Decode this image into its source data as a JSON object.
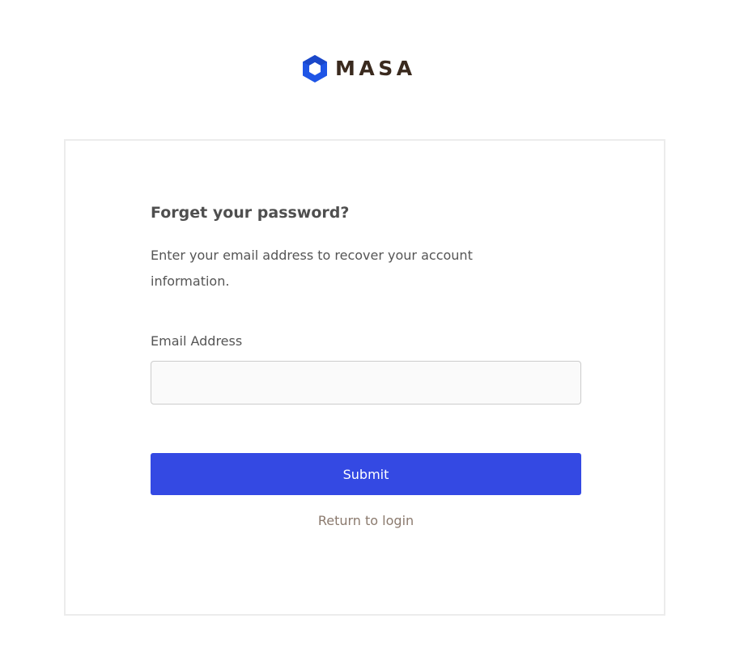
{
  "brand": {
    "logo_icon": "hexagon-logo-icon",
    "name": "MASA",
    "icon_color": "#1f55e6",
    "text_color": "#3a2a1e"
  },
  "form": {
    "title": "Forget your password?",
    "description": "Enter your email address to recover your account information.",
    "email_label": "Email Address",
    "email_value": "",
    "email_placeholder": "",
    "submit_label": "Submit",
    "return_link": "Return to login"
  },
  "colors": {
    "primary": "#3449e3",
    "link": "#8b7a6e",
    "card_border": "#ececec"
  }
}
